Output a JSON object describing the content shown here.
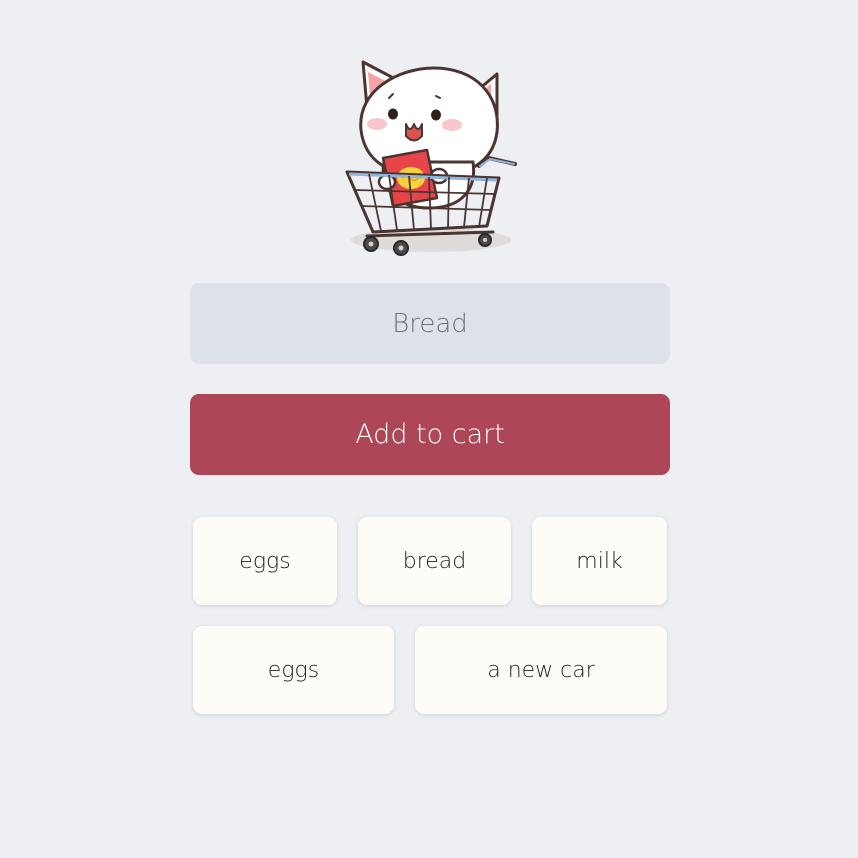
{
  "mascot": {
    "icon": "cat-in-shopping-cart-icon"
  },
  "input": {
    "placeholder": "Bread"
  },
  "add_button": {
    "label": "Add to cart",
    "color": "#ad4657"
  },
  "cart_items": [
    {
      "label": "eggs"
    },
    {
      "label": "bread"
    },
    {
      "label": "milk"
    },
    {
      "label": "eggs"
    },
    {
      "label": "a new car"
    }
  ],
  "colors": {
    "background": "#eeeff3",
    "input_background": "#dde1ea",
    "item_background": "#fdfcf7"
  }
}
